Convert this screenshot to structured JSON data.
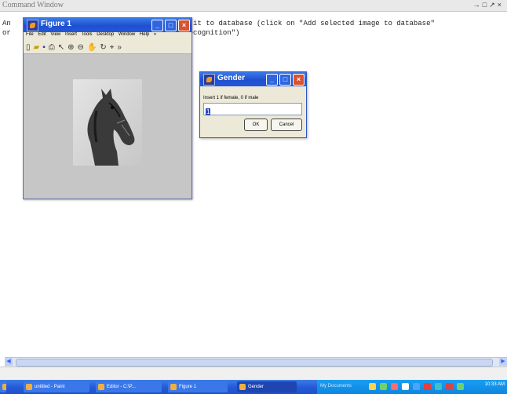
{
  "command_window": {
    "title": "Command Window",
    "controls": "→□↗×",
    "line1": "An                                 u can add it to database (click on \"Add selected image to database\"",
    "line2": "or                                 \"Gender Recognition\")"
  },
  "figure": {
    "title": "Figure 1",
    "menu": [
      "File",
      "Edit",
      "View",
      "Insert",
      "Tools",
      "Desktop",
      "Window",
      "Help",
      "»"
    ],
    "toolbar_icons": [
      "new-file-icon",
      "open-file-icon",
      "save-icon",
      "print-icon",
      "pointer-icon",
      "zoom-in-icon",
      "zoom-out-icon",
      "pan-icon",
      "rotate-icon",
      "data-cursor-icon",
      "more-icon"
    ]
  },
  "dialog": {
    "title": "Gender",
    "prompt": "Insert 1 if female, 0 if male",
    "input_value": "1",
    "ok_label": "OK",
    "cancel_label": "Cancel"
  },
  "taskbar": {
    "items": [
      "untitled - Paint",
      "Editor - C:\\P...",
      "Figure 1",
      "Gender",
      "My Documents"
    ],
    "active_index": 3,
    "clock": "10:33 AM"
  },
  "colors": {
    "xp_title_blue": "#245bd8",
    "close_red": "#d9532f",
    "matlab_orange": "#f39a1f",
    "tray_blue": "#0d86e0"
  }
}
